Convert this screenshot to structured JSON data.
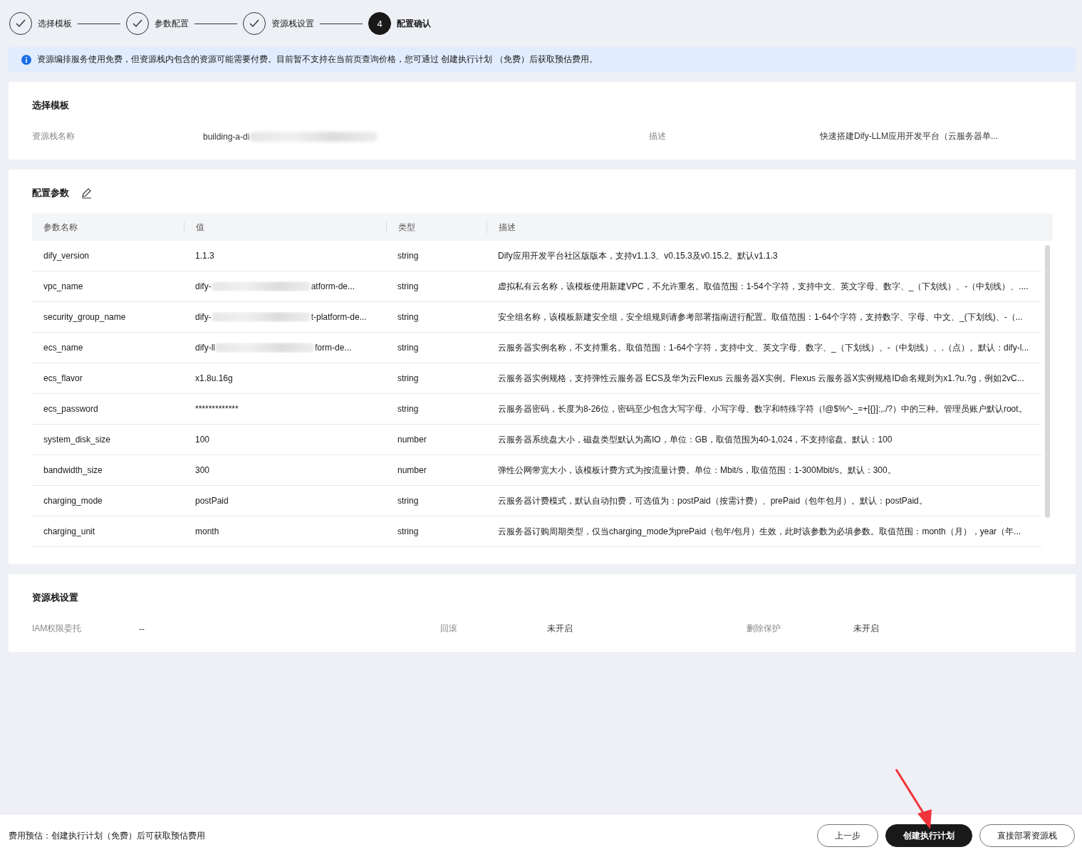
{
  "steps": [
    {
      "label": "选择模板",
      "completed": true
    },
    {
      "label": "参数配置",
      "completed": true
    },
    {
      "label": "资源栈设置",
      "completed": true
    },
    {
      "label": "配置确认",
      "completed": false,
      "number": "4"
    }
  ],
  "notice": "资源编排服务使用免费，但资源栈内包含的资源可能需要付费。目前暂不支持在当前页查询价格，您可通过 创建执行计划 （免费）后获取预估费用。",
  "template": {
    "title": "选择模板",
    "fields": [
      {
        "label": "资源栈名称",
        "value": "building-a-di",
        "redacted": true
      },
      {
        "label": "描述",
        "value": "快速搭建Dify-LLM应用开发平台（云服务器单..."
      }
    ]
  },
  "params": {
    "title": "配置参数",
    "columns": [
      "参数名称",
      "值",
      "类型",
      "描述"
    ],
    "rows": [
      {
        "name": "dify_version",
        "value": "1.1.3",
        "type": "string",
        "desc": "Dify应用开发平台社区版版本，支持v1.1.3、v0.15.3及v0.15.2。默认v1.1.3"
      },
      {
        "name": "vpc_name",
        "value": "dify-",
        "value_end": "atform-de...",
        "redacted": true,
        "type": "string",
        "desc": "虚拟私有云名称，该模板使用新建VPC，不允许重名。取值范围：1-54个字符，支持中文、英文字母、数字、_（下划线）、-（中划线）、...."
      },
      {
        "name": "security_group_name",
        "value": "dify-",
        "value_end": "t-platform-de...",
        "redacted": true,
        "type": "string",
        "desc": "安全组名称，该模板新建安全组，安全组规则请参考部署指南进行配置。取值范围：1-64个字符，支持数字、字母、中文、_(下划线)、-（..."
      },
      {
        "name": "ecs_name",
        "value": "dify-ll",
        "value_end": "form-de...",
        "redacted": true,
        "type": "string",
        "desc": "云服务器实例名称，不支持重名。取值范围：1-64个字符，支持中文、英文字母、数字、_（下划线）、-（中划线）、.（点）。默认：dify-l..."
      },
      {
        "name": "ecs_flavor",
        "value": "x1.8u.16g",
        "type": "string",
        "desc": "云服务器实例规格，支持弹性云服务器 ECS及华为云Flexus 云服务器X实例。Flexus 云服务器X实例规格ID命名规则为x1.?u.?g，例如2vC..."
      },
      {
        "name": "ecs_password",
        "value": "*************",
        "type": "string",
        "desc": "云服务器密码，长度为8-26位，密码至少包含大写字母、小写字母、数字和特殊字符（!@$%^-_=+[{}]:,./?）中的三种。管理员账户默认root。"
      },
      {
        "name": "system_disk_size",
        "value": "100",
        "type": "number",
        "desc": "云服务器系统盘大小，磁盘类型默认为高IO，单位：GB，取值范围为40-1,024，不支持缩盘。默认：100"
      },
      {
        "name": "bandwidth_size",
        "value": "300",
        "type": "number",
        "desc": "弹性公网带宽大小，该模板计费方式为按流量计费。单位：Mbit/s，取值范围：1-300Mbit/s。默认：300。"
      },
      {
        "name": "charging_mode",
        "value": "postPaid",
        "type": "string",
        "desc": "云服务器计费模式，默认自动扣费，可选值为：postPaid（按需计费）、prePaid（包年包月）。默认：postPaid。"
      },
      {
        "name": "charging_unit",
        "value": "month",
        "type": "string",
        "desc": "云服务器订购周期类型，仅当charging_mode为prePaid（包年/包月）生效，此时该参数为必填参数。取值范围：month（月），year（年..."
      }
    ]
  },
  "stack": {
    "title": "资源栈设置",
    "fields": [
      {
        "label": "IAM权限委托",
        "value": "--"
      },
      {
        "label": "回滚",
        "value": "未开启"
      },
      {
        "label": "删除保护",
        "value": "未开启"
      }
    ]
  },
  "footer": {
    "estimate": "费用预估：创建执行计划（免费）后可获取预估费用",
    "buttons": [
      {
        "label": "上一步",
        "kind": "outline"
      },
      {
        "label": "创建执行计划",
        "kind": "primary",
        "highlighted": true
      },
      {
        "label": "直接部署资源栈",
        "kind": "outline"
      }
    ]
  }
}
